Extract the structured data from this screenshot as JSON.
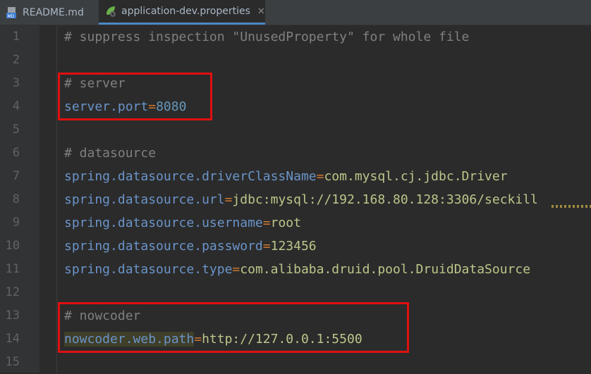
{
  "tabs": [
    {
      "label": "README.md",
      "icon": "markdown-file-icon"
    },
    {
      "label": "application-dev.properties",
      "icon": "spring-leaf-icon",
      "active": true
    }
  ],
  "lines": [
    {
      "num": "1",
      "comment": "# suppress inspection \"UnusedProperty\" for whole file"
    },
    {
      "num": "2"
    },
    {
      "num": "3",
      "comment": "# server"
    },
    {
      "num": "4",
      "key": "server.port",
      "eq": "=",
      "value": "8080"
    },
    {
      "num": "5"
    },
    {
      "num": "6",
      "comment": "# datasource"
    },
    {
      "num": "7",
      "key": "spring.datasource.driverClassName",
      "eq": "=",
      "value": "com.mysql.cj.jdbc.Driver"
    },
    {
      "num": "8",
      "key": "spring.datasource.url",
      "eq": "=",
      "value": "jdbc:mysql://192.168.80.128:3306/seckill"
    },
    {
      "num": "9",
      "key": "spring.datasource.username",
      "eq": "=",
      "value": "root"
    },
    {
      "num": "10",
      "key": "spring.datasource.password",
      "eq": "=",
      "value": "123456"
    },
    {
      "num": "11",
      "key": "spring.datasource.type",
      "eq": "=",
      "value": "com.alibaba.druid.pool.DruidDataSource"
    },
    {
      "num": "12"
    },
    {
      "num": "13",
      "comment": "# nowcoder"
    },
    {
      "num": "14",
      "key": "nowcoder.web.path",
      "eq": "=",
      "value": "http://127.0.0.1:5500"
    },
    {
      "num": "15"
    }
  ],
  "colors": {
    "highlight_box": "#e01010",
    "comment": "#808080",
    "key": "#6a94c9",
    "value": "#a5c261"
  }
}
